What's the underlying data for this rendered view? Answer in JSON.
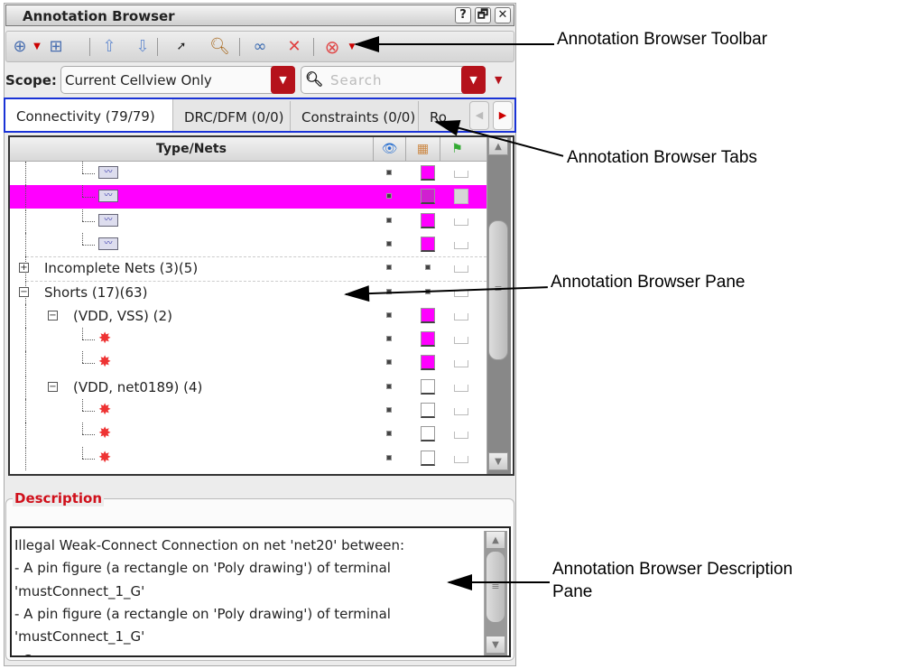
{
  "window": {
    "title": "Annotation Browser",
    "help": "?",
    "float": "🗗",
    "close": "✕"
  },
  "toolbar": {
    "items": [
      "zoom-fit",
      "dropdown",
      "zoom-to",
      "up",
      "down",
      "select",
      "magnify",
      "show-all",
      "hide-all",
      "stop",
      "dropdown"
    ]
  },
  "scope": {
    "label": "Scope:",
    "value": "Current Cellview Only",
    "search_placeholder": "Search"
  },
  "tabs": [
    "Connectivity (79/79)",
    "DRC/DFM (0/0)",
    "Constraints (0/0)",
    "Ro"
  ],
  "tree": {
    "header": "Type/Nets",
    "rows": [
      {
        "level": 3,
        "kind": "net",
        "label": "",
        "swatch": "#ff00ff",
        "flag": "empty"
      },
      {
        "level": 3,
        "kind": "net",
        "label": "",
        "swatch": "#d020d0",
        "flag": "box",
        "selected": true
      },
      {
        "level": 3,
        "kind": "net",
        "label": "",
        "swatch": "#ff00ff",
        "flag": "empty"
      },
      {
        "level": 3,
        "kind": "net",
        "label": "",
        "swatch": "#ff00ff",
        "flag": "empty"
      },
      {
        "level": 1,
        "kind": "group",
        "expand": "+",
        "label": "Incomplete Nets (3)(5)",
        "swatch": "dot",
        "flag": "empty"
      },
      {
        "level": 1,
        "kind": "group",
        "expand": "−",
        "label": "Shorts (17)(63)",
        "swatch": "dot",
        "flag": "empty"
      },
      {
        "level": 2,
        "kind": "group",
        "expand": "−",
        "label": "(VDD, VSS) (2)",
        "swatch": "#ff00ff",
        "flag": "empty"
      },
      {
        "level": 3,
        "kind": "short",
        "label": "",
        "swatch": "#ff00ff",
        "flag": "empty"
      },
      {
        "level": 3,
        "kind": "short",
        "label": "",
        "swatch": "#ff00ff",
        "flag": "empty"
      },
      {
        "level": 2,
        "kind": "group",
        "expand": "−",
        "label": "(VDD, net0189) (4)",
        "swatch": "#ffffff",
        "flag": "empty"
      },
      {
        "level": 3,
        "kind": "short",
        "label": "",
        "swatch": "#ffffff",
        "flag": "empty"
      },
      {
        "level": 3,
        "kind": "short",
        "label": "",
        "swatch": "#ffffff",
        "flag": "empty"
      },
      {
        "level": 3,
        "kind": "short",
        "label": "",
        "swatch": "#ffffff",
        "flag": "empty"
      }
    ]
  },
  "description": {
    "title": "Description",
    "lines": [
      "Illegal Weak-Connect Connection on net 'net20' between:",
      "- A pin figure (a rectangle on 'Poly drawing') of terminal",
      "'mustConnect_1_G'",
      "- A pin figure (a rectangle on 'Poly drawing') of terminal",
      "'mustConnect_1_G'",
      "- S..."
    ]
  },
  "callouts": {
    "toolbar": "Annotation Browser Toolbar",
    "tabs": "Annotation Browser Tabs",
    "pane": "Annotation Browser Pane",
    "desc1": "Annotation Browser Description",
    "desc2": "Pane"
  }
}
